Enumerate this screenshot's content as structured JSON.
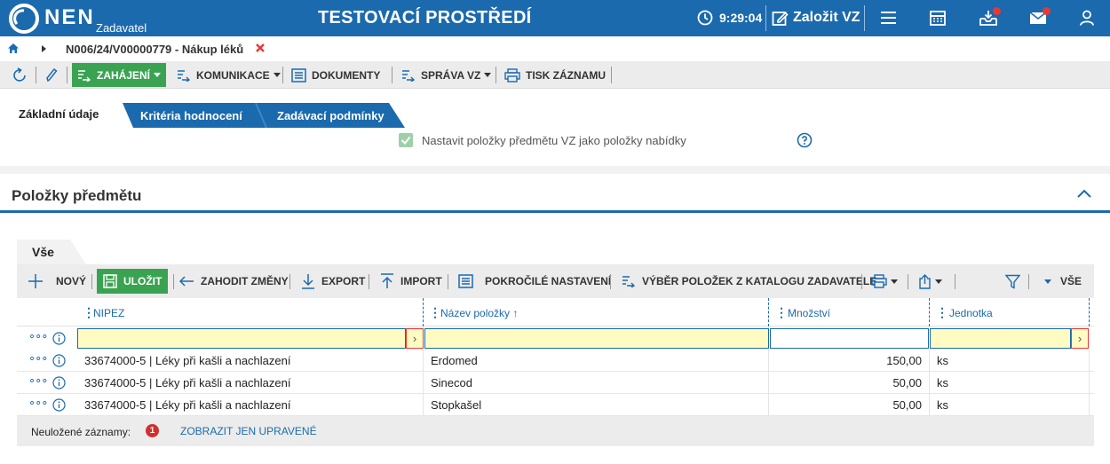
{
  "colors": {
    "brand_blue": "#1b6aae",
    "green": "#3aa352",
    "red": "#e53935",
    "highlight_yellow": "#fffbc2"
  },
  "header": {
    "brand": "NEN",
    "brand_sub": "Zadavatel",
    "env_title": "TESTOVACÍ PROSTŘEDÍ",
    "clock": "9:29:04",
    "create_label": "Založit VZ",
    "icons": [
      "clock-icon",
      "create-edit-icon",
      "hamburger-menu-icon",
      "calendar-icon",
      "inbox-icon",
      "mail-icon",
      "user-icon"
    ]
  },
  "breadcrumb": {
    "text": "N006/24/V00000779 - Nákup léků"
  },
  "toolbar": {
    "zahajeni": "ZAHÁJENÍ",
    "komunikace": "KOMUNIKACE",
    "dokumenty": "DOKUMENTY",
    "sprava": "SPRÁVA VZ",
    "tisk": "TISK ZÁZNAMU"
  },
  "tabs": [
    "Základní údaje",
    "Kritéria hodnocení",
    "Zadávací podmínky"
  ],
  "checkbox_label": "Nastavit položky předmětu VZ jako položky nabídky",
  "section": {
    "title": "Položky předmětu"
  },
  "subtab": "Vše",
  "gridbar": {
    "new": "NOVÝ",
    "save": "ULOŽIT",
    "discard": "ZAHODIT ZMĚNY",
    "export": "EXPORT",
    "import": "IMPORT",
    "advanced": "POKROČILÉ NASTAVENÍ",
    "catalog": "VÝBĚR POLOŽEK Z KATALOGU ZADAVATELE",
    "view": "VŠE"
  },
  "columns": {
    "nipez": "NIPEZ",
    "name": "Název položky",
    "qty": "Množství",
    "unit": "Jednotka"
  },
  "rows": [
    {
      "nipez": "33674000-5 | Léky při kašli a nachlazení",
      "name": "Erdomed",
      "qty": "150,00",
      "unit": "ks"
    },
    {
      "nipez": "33674000-5 | Léky při kašli a nachlazení",
      "name": "Sinecod",
      "qty": "50,00",
      "unit": "ks"
    },
    {
      "nipez": "33674000-5 | Léky při kašli a nachlazení",
      "name": "Stopkašel",
      "qty": "50,00",
      "unit": "ks"
    }
  ],
  "footer": {
    "unsaved_label": "Neuložené záznamy:",
    "unsaved_count": "1",
    "link": "ZOBRAZIT JEN UPRAVENÉ"
  }
}
